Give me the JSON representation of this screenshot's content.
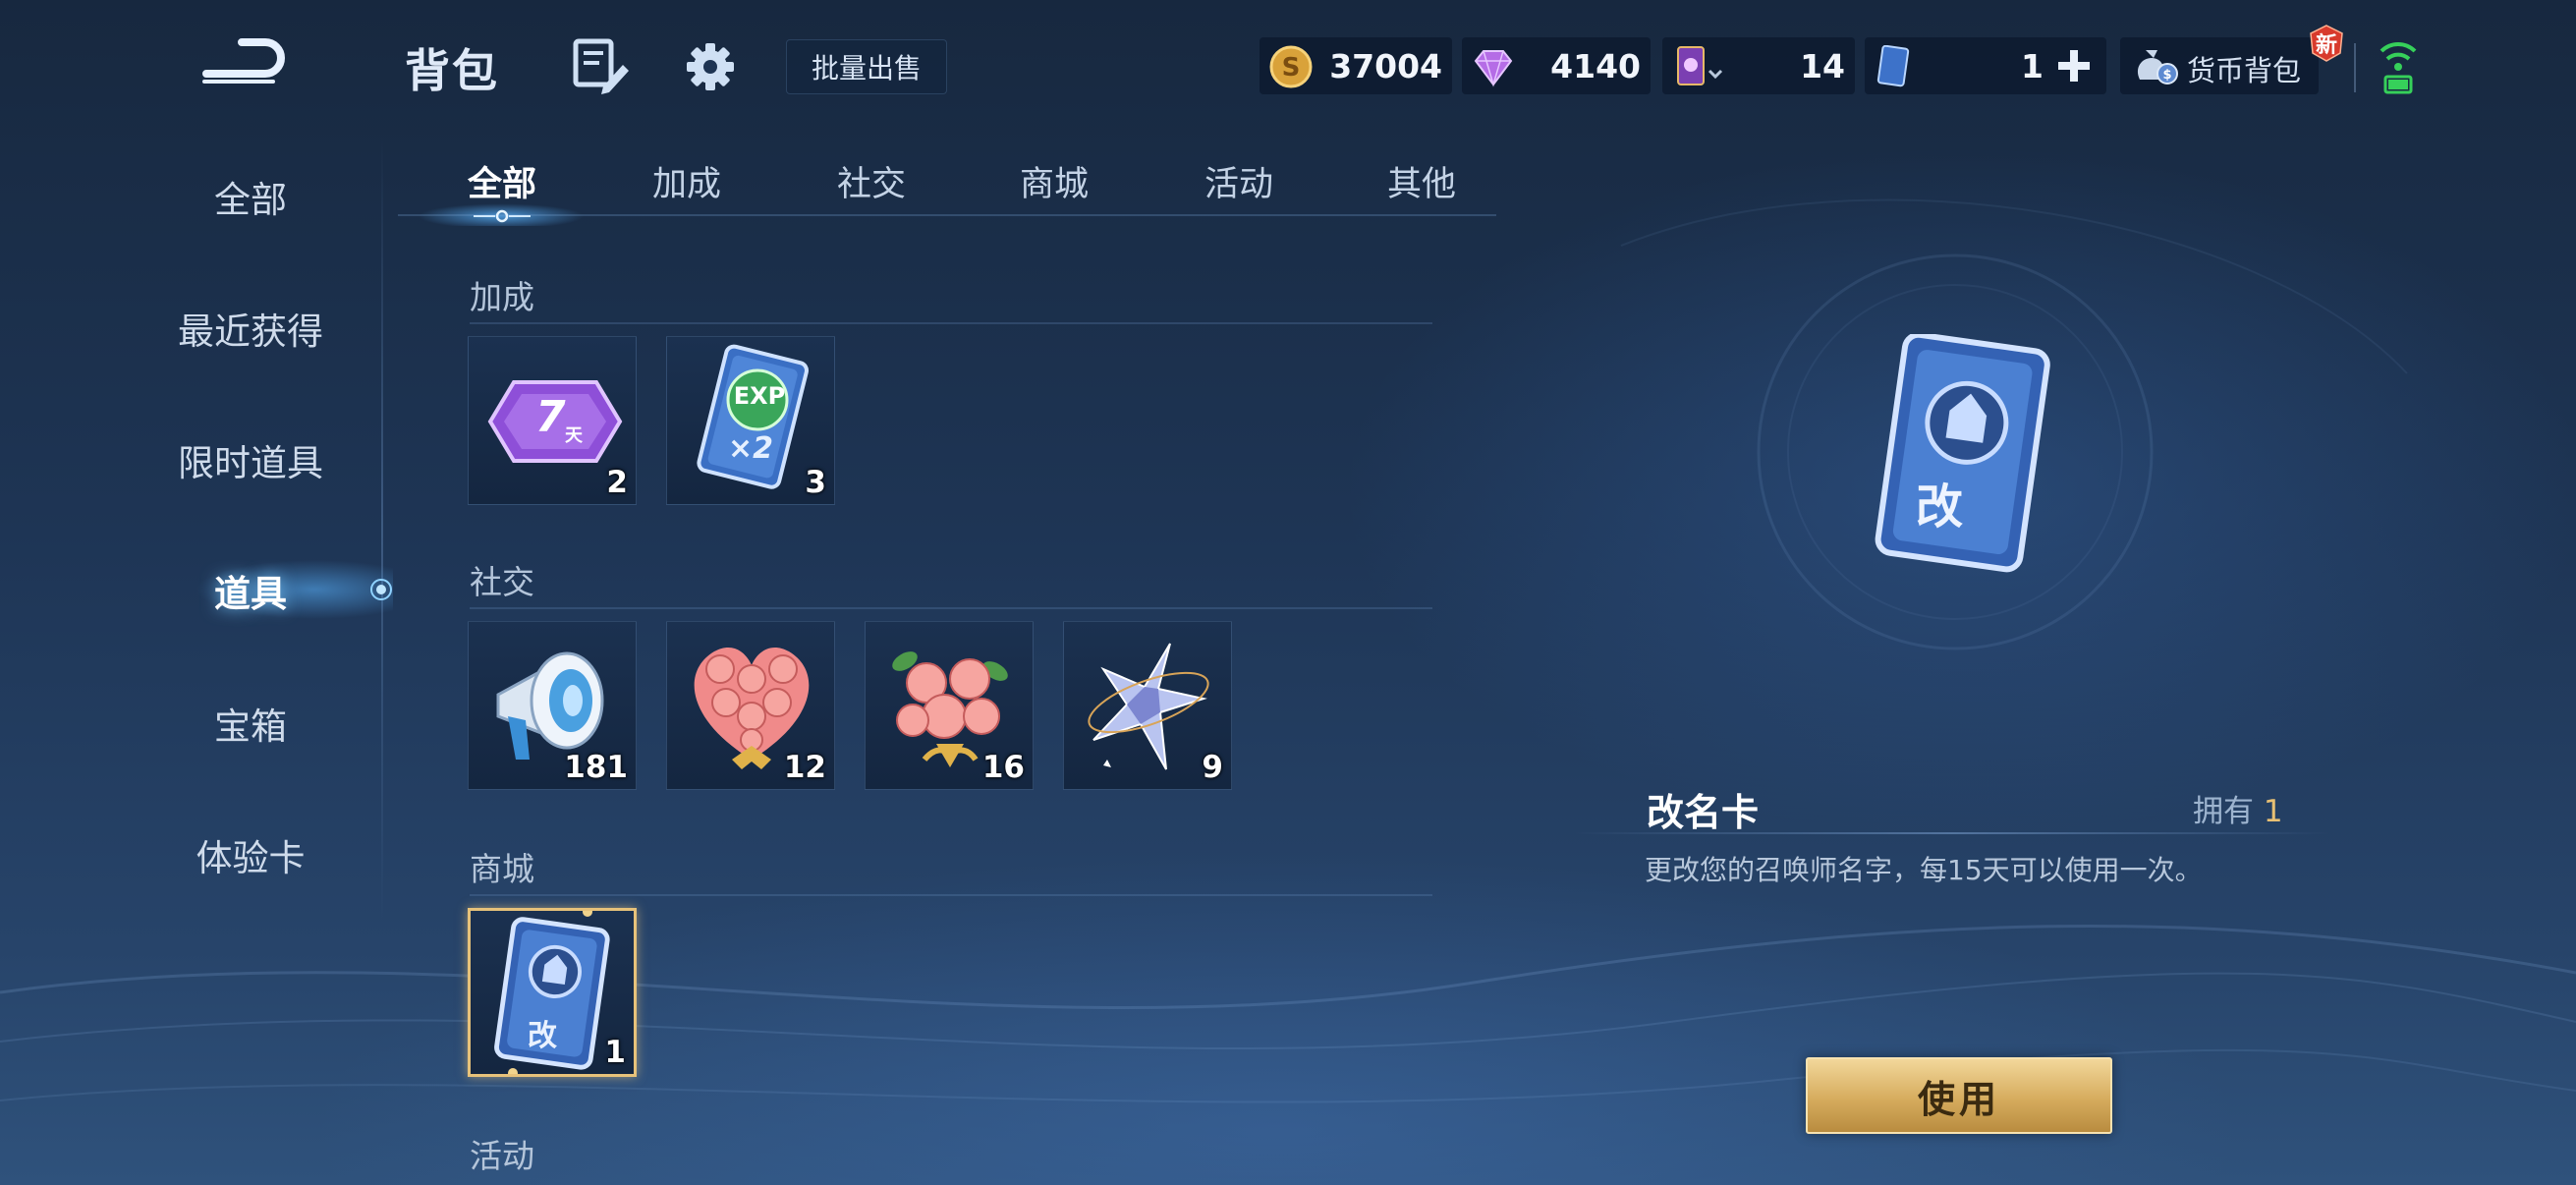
{
  "header": {
    "title": "背包",
    "bulk_sell_label": "批量出售"
  },
  "currencies": [
    {
      "name": "gold-coin",
      "value": "37004"
    },
    {
      "name": "diamond",
      "value": "4140"
    },
    {
      "name": "hero-card",
      "value": "14"
    },
    {
      "name": "ticket-card",
      "value": "1"
    }
  ],
  "wallet": {
    "label": "货币背包",
    "badge": "新"
  },
  "sidebar": {
    "items": [
      {
        "label": "全部"
      },
      {
        "label": "最近获得"
      },
      {
        "label": "限时道具"
      },
      {
        "label": "道具",
        "active": true
      },
      {
        "label": "宝箱"
      },
      {
        "label": "体验卡"
      }
    ]
  },
  "tabs": [
    {
      "label": "全部",
      "active": true
    },
    {
      "label": "加成"
    },
    {
      "label": "社交"
    },
    {
      "label": "商城"
    },
    {
      "label": "活动"
    },
    {
      "label": "其他"
    }
  ],
  "sections": [
    {
      "title": "加成",
      "items": [
        {
          "icon": "7-day-card-icon",
          "icon_text": "7",
          "icon_sub": "天",
          "count": "2"
        },
        {
          "icon": "exp-double-card-icon",
          "icon_text": "EXP",
          "icon_sub": "×2",
          "count": "3"
        }
      ]
    },
    {
      "title": "社交",
      "items": [
        {
          "icon": "megaphone-icon",
          "count": "181"
        },
        {
          "icon": "rose-heart-bouquet-icon",
          "count": "12"
        },
        {
          "icon": "rose-bouquet-icon",
          "count": "16"
        },
        {
          "icon": "crystal-star-icon",
          "count": "9"
        }
      ]
    },
    {
      "title": "商城",
      "items": [
        {
          "icon": "rename-card-icon",
          "icon_text": "改",
          "count": "1",
          "selected": true
        }
      ]
    },
    {
      "title": "活动",
      "items": []
    }
  ],
  "detail": {
    "name": "改名卡",
    "own_label": "拥有",
    "own_count": "1",
    "description": "更改您的召唤师名字，每15天可以使用一次。",
    "card_text": "改",
    "use_button": "使用"
  },
  "colors": {
    "accent_gold": "#e8c074",
    "active_glow": "#5ab4ff",
    "background": "#1e3555"
  }
}
